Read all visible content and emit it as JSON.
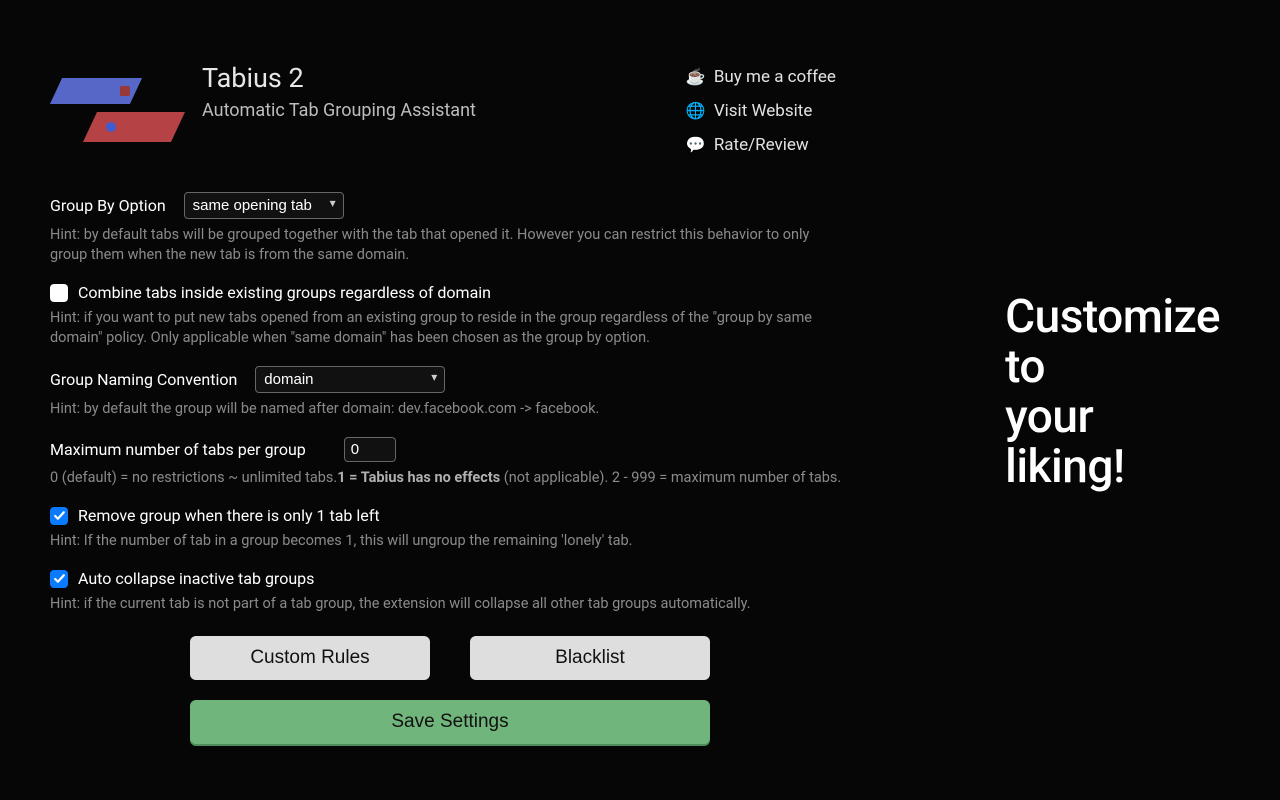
{
  "header": {
    "title": "Tabius 2",
    "subtitle": "Automatic Tab Grouping Assistant"
  },
  "links": {
    "coffee": {
      "emoji": "☕",
      "label": "Buy me a coffee"
    },
    "website": {
      "emoji": "🌐",
      "label": "Visit Website"
    },
    "rate": {
      "emoji": "💬",
      "label": "Rate/Review"
    }
  },
  "settings": {
    "groupBy": {
      "label": "Group By Option",
      "value": "same opening tab",
      "hint": "Hint: by default tabs will be grouped together with the tab that opened it. However you can restrict this behavior to only group them when the new tab is from the same domain."
    },
    "combine": {
      "label": "Combine tabs inside existing groups regardless of domain",
      "checked": false,
      "hint": "Hint: if you want to put new tabs opened from an existing group to reside in the group regardless of the \"group by same domain\" policy. Only applicable when \"same domain\" has been chosen as the group by option."
    },
    "naming": {
      "label": "Group Naming Convention",
      "value": "domain",
      "hint": "Hint: by default the group will be named after domain: dev.facebook.com -> facebook."
    },
    "maxTabs": {
      "label": "Maximum number of tabs per group",
      "value": "0",
      "hint_pre": "0 (default) = no restrictions ~ unlimited tabs.",
      "hint_bold": "1 = Tabius has no effects",
      "hint_post": " (not applicable). 2 - 999 = maximum number of tabs."
    },
    "removeLonely": {
      "label": "Remove group when there is only 1 tab left",
      "checked": true,
      "hint": "Hint: If the number of tab in a group becomes 1, this will ungroup the remaining 'lonely' tab."
    },
    "autoCollapse": {
      "label": "Auto collapse inactive tab groups",
      "checked": true,
      "hint": "Hint: if the current tab is not part of a tab group, the extension will collapse all other tab groups automatically."
    }
  },
  "buttons": {
    "customRules": "Custom Rules",
    "blacklist": "Blacklist",
    "save": "Save Settings"
  },
  "aside": {
    "line1": "Customize",
    "line2": "to",
    "line3": "your",
    "line4": "liking!"
  }
}
